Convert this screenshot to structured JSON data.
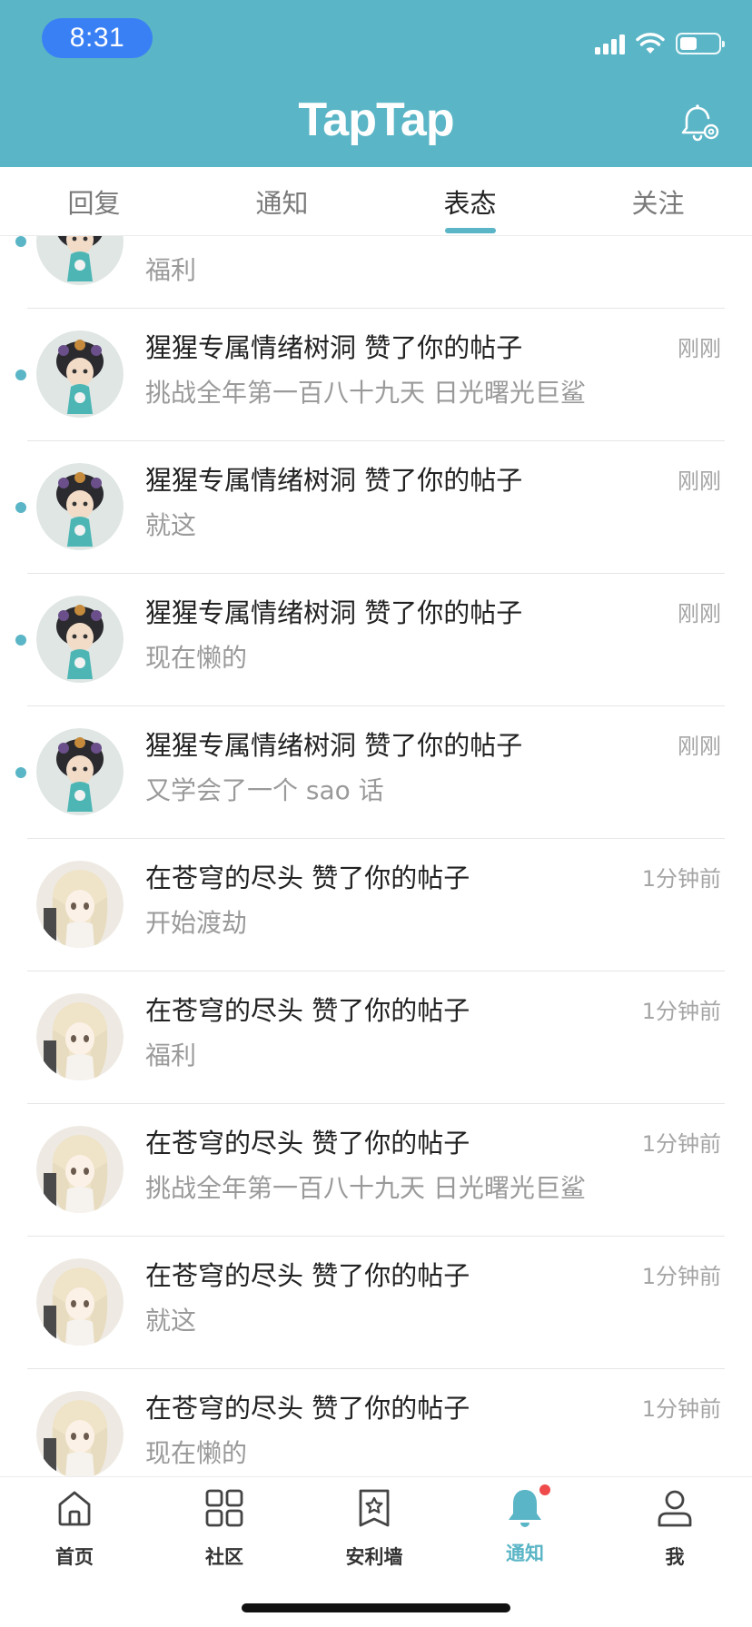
{
  "status_bar": {
    "time": "8:31"
  },
  "header": {
    "app_title": "TapTap"
  },
  "tabs": [
    {
      "label": "回复",
      "active": false
    },
    {
      "label": "通知",
      "active": false
    },
    {
      "label": "表态",
      "active": true
    },
    {
      "label": "关注",
      "active": false
    }
  ],
  "notifications": [
    {
      "avatar": "avatar-doll",
      "title": "",
      "subtitle": "福利",
      "time": "",
      "unread": true
    },
    {
      "avatar": "avatar-doll",
      "title": "猩猩专属情绪树洞 赞了你的帖子",
      "subtitle": "挑战全年第一百八十九天 日光曙光巨鲨",
      "time": "刚刚",
      "unread": true
    },
    {
      "avatar": "avatar-doll",
      "title": "猩猩专属情绪树洞 赞了你的帖子",
      "subtitle": "就这",
      "time": "刚刚",
      "unread": true
    },
    {
      "avatar": "avatar-doll",
      "title": "猩猩专属情绪树洞 赞了你的帖子",
      "subtitle": "现在懒的",
      "time": "刚刚",
      "unread": true
    },
    {
      "avatar": "avatar-doll",
      "title": "猩猩专属情绪树洞 赞了你的帖子",
      "subtitle": "又学会了一个 sao 话",
      "time": "刚刚",
      "unread": true
    },
    {
      "avatar": "avatar-anime-girl",
      "title": "在苍穹的尽头 赞了你的帖子",
      "subtitle": "开始渡劫",
      "time": "1分钟前",
      "unread": false
    },
    {
      "avatar": "avatar-anime-girl",
      "title": "在苍穹的尽头 赞了你的帖子",
      "subtitle": "福利",
      "time": "1分钟前",
      "unread": false
    },
    {
      "avatar": "avatar-anime-girl",
      "title": "在苍穹的尽头 赞了你的帖子",
      "subtitle": "挑战全年第一百八十九天 日光曙光巨鲨",
      "time": "1分钟前",
      "unread": false
    },
    {
      "avatar": "avatar-anime-girl",
      "title": "在苍穹的尽头 赞了你的帖子",
      "subtitle": "就这",
      "time": "1分钟前",
      "unread": false
    },
    {
      "avatar": "avatar-anime-girl",
      "title": "在苍穹的尽头 赞了你的帖子",
      "subtitle": "现在懒的",
      "time": "1分钟前",
      "unread": false
    }
  ],
  "bottom_nav": [
    {
      "label": "首页",
      "icon": "home-icon",
      "active": false
    },
    {
      "label": "社区",
      "icon": "grid-icon",
      "active": false
    },
    {
      "label": "安利墙",
      "icon": "star-bookmark-icon",
      "active": false
    },
    {
      "label": "通知",
      "icon": "bell-icon",
      "active": true,
      "badge": true
    },
    {
      "label": "我",
      "icon": "user-icon",
      "active": false
    }
  ],
  "colors": {
    "brand": "#5ab5c6",
    "status_pill": "#3a80f5",
    "badge": "#ef4b4b"
  }
}
